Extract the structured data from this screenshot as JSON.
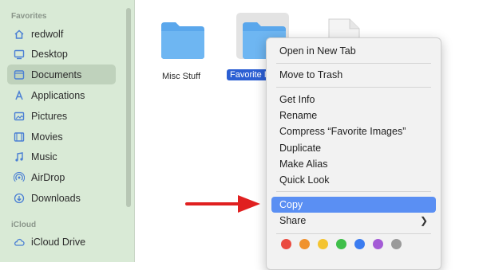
{
  "sidebar": {
    "favorites_title": "Favorites",
    "items": [
      {
        "label": "redwolf",
        "icon": "home-icon"
      },
      {
        "label": "Desktop",
        "icon": "desktop-icon"
      },
      {
        "label": "Documents",
        "icon": "document-folder-icon",
        "selected": true
      },
      {
        "label": "Applications",
        "icon": "applications-icon"
      },
      {
        "label": "Pictures",
        "icon": "pictures-icon"
      },
      {
        "label": "Movies",
        "icon": "movies-icon"
      },
      {
        "label": "Music",
        "icon": "music-icon"
      },
      {
        "label": "AirDrop",
        "icon": "airdrop-icon"
      },
      {
        "label": "Downloads",
        "icon": "downloads-icon"
      }
    ],
    "icloud_title": "iCloud",
    "icloud_items": [
      {
        "label": "iCloud Drive",
        "icon": "cloud-icon"
      }
    ]
  },
  "files": [
    {
      "label": "Misc Stuff",
      "icon": "folder-icon"
    },
    {
      "label": "Favorite Images",
      "icon": "folder-icon",
      "selected": true
    }
  ],
  "context_menu": {
    "items": [
      {
        "label": "Open in New Tab"
      },
      {
        "label": "Move to Trash"
      },
      {
        "label": "Get Info"
      },
      {
        "label": "Rename"
      },
      {
        "label": "Compress “Favorite Images”"
      },
      {
        "label": "Duplicate"
      },
      {
        "label": "Make Alias"
      },
      {
        "label": "Quick Look"
      },
      {
        "label": "Copy",
        "highlighted": true
      },
      {
        "label": "Share",
        "submenu": true
      }
    ],
    "tag_colors": [
      "#ea4b40",
      "#f0922e",
      "#f4c430",
      "#3fbf4a",
      "#3b7cf0",
      "#a45bd6",
      "#9a9a9a"
    ]
  },
  "colors": {
    "accent": "#2c5fd3",
    "menu_highlight": "#5a8ff3",
    "sidebar_bg": "#d9ead6",
    "annotation_arrow": "#e02020"
  }
}
